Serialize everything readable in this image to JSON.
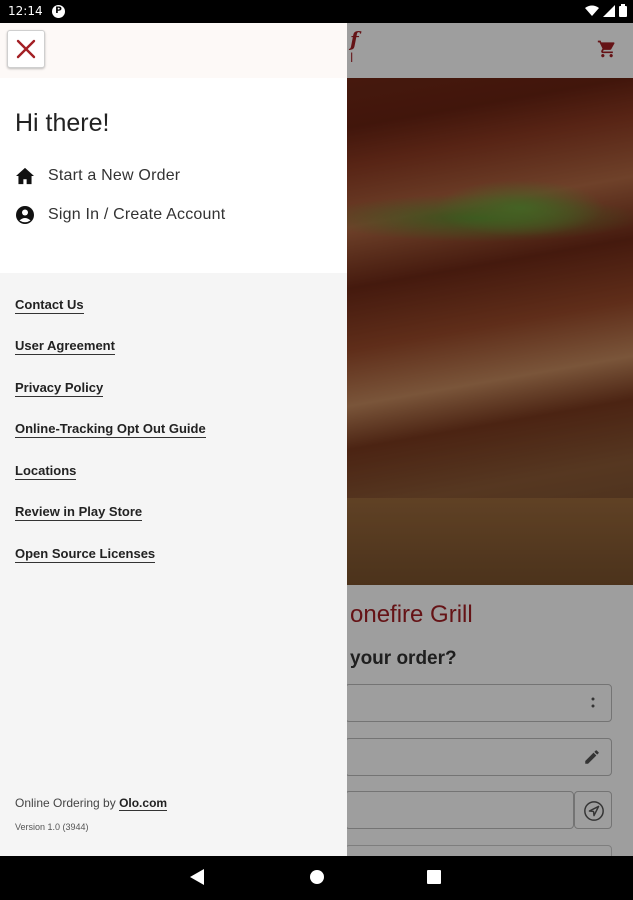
{
  "status_bar": {
    "time": "12:14",
    "notification_letter": "P"
  },
  "background_app": {
    "logo_fragment": "f",
    "logo_fragment_sub": "l",
    "restaurant_name_fragment": "onefire Grill",
    "question_fragment": "your order?"
  },
  "drawer": {
    "greeting": "Hi there!",
    "nav_items": [
      {
        "label": "Start a New Order",
        "icon": "home-icon"
      },
      {
        "label": "Sign In / Create Account",
        "icon": "account-circle-icon"
      }
    ],
    "links": [
      "Contact Us",
      "User Agreement",
      "Privacy Policy",
      "Online-Tracking Opt Out Guide",
      "Locations",
      "Review in Play Store",
      "Open Source Licenses"
    ],
    "footer": {
      "prefix": "Online Ordering by ",
      "olo_link": "Olo.com",
      "version": "Version 1.0 (3944)"
    }
  },
  "colors": {
    "brand_red": "#a31f24",
    "drawer_background": "#f5f5f5"
  }
}
